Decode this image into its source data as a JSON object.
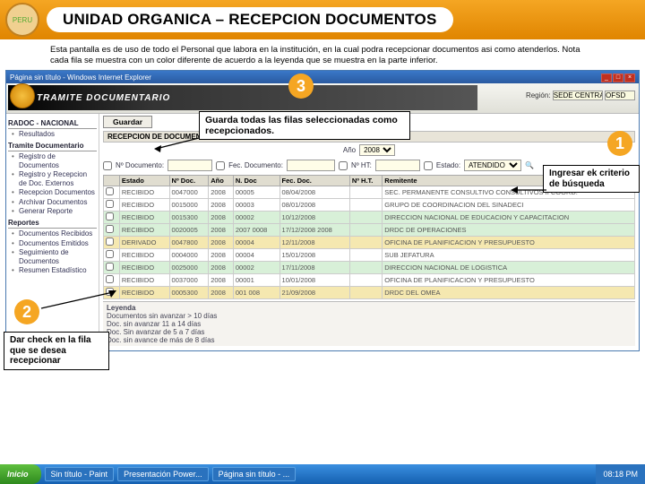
{
  "header": {
    "title": "UNIDAD ORGANICA – RECEPCION DOCUMENTOS",
    "logo_sub": "PERU"
  },
  "intro": "Esta pantalla es de uso de todo el Personal que labora en la institución, en la cual podra recepcionar documentos asi como atenderlos. Nota cada fila se muestra con un color diferente de acuerdo a la leyenda que se muestra en la parte inferior.",
  "ie": {
    "title": "Página sin título - Windows Internet Explorer",
    "app_banner": "TRAMITE DOCUMENTARIO",
    "region_lbl": "Región:",
    "region_val": "SEDE CENTRAL",
    "unit_lbl": "",
    "unit_val": "OFSD"
  },
  "sidebar": {
    "groups": [
      {
        "head": "RADOC - NACIONAL",
        "items": [
          "Resultados"
        ]
      },
      {
        "head": "Tramite Documentario",
        "items": [
          "Registro de Documentos",
          "Registro y Recepcion de Doc. Externos",
          "Recepcion Documentos",
          "Archivar Documentos",
          "Generar Reporte"
        ]
      },
      {
        "head": "Reportes",
        "items": [
          "Documentos Recibidos",
          "Documentos Emitidos",
          "Seguimiento de Documentos",
          "Resumen Estadístico"
        ]
      }
    ]
  },
  "main": {
    "guardar": "Guardar",
    "panel_title": "RECEPCION DE DOCUMENTOS INTERNOS",
    "year_lbl": "Año",
    "year_val": "2008",
    "filters": {
      "f1": "Nº Documento:",
      "f2": "Fec. Documento:",
      "f3": "Nº HT:",
      "f4": "Estado:",
      "estado_val": "ATENDIDO",
      "search_icon": "🔍"
    },
    "cols": [
      "",
      "Estado",
      "Nº Doc.",
      "Año",
      "N. Doc",
      "Fec. Doc.",
      "Nº H.T.",
      "Remitente"
    ],
    "rows": [
      [
        "RECIBIDO",
        "0047000",
        "2008",
        "00005",
        "08/04/2008",
        "",
        "SEC. PERMANENTE CONSULTIVO CONSULTIVOS II COORD."
      ],
      [
        "RECIBIDO",
        "0015000",
        "2008",
        "00003",
        "08/01/2008",
        "",
        "GRUPO DE COORDINACION DEL SINADECI"
      ],
      [
        "RECIBIDO",
        "0015300",
        "2008",
        "00002",
        "10/12/2008",
        "",
        "DIRECCION NACIONAL DE EDUCACION Y CAPACITACION"
      ],
      [
        "RECIBIDO",
        "0020005",
        "2008",
        "2007 0008",
        "17/12/2008 2008",
        "",
        "DRDC DE OPERACIONES"
      ],
      [
        "DERIVADO",
        "0047800",
        "2008",
        "00004",
        "12/11/2008",
        "",
        "OFICINA DE PLANIFICACION Y PRESUPUESTO"
      ],
      [
        "RECIBIDO",
        "0004000",
        "2008",
        "00004",
        "15/01/2008",
        "",
        "SUB JEFATURA"
      ],
      [
        "RECIBIDO",
        "0025000",
        "2008",
        "00002",
        "17/11/2008",
        "",
        "DIRECCION NACIONAL DE LOGISTICA"
      ],
      [
        "RECIBIDO",
        "0037000",
        "2008",
        "00001",
        "10/01/2008",
        "",
        "OFICINA DE PLANIFICACION Y PRESUPUESTO"
      ],
      [
        "RECIBIDO",
        "0005300",
        "2008",
        "001 008",
        "21/09/2008",
        "",
        "DRDC DEL OMEA"
      ]
    ],
    "legend_head": "Leyenda",
    "legend": [
      "Documentos sin avanzar > 10 días",
      "Doc. sin avanzar 11 a 14 días",
      "Doc. Sin avanzar de 5 a 7 días",
      "Doc. sin avance de más de 8 días"
    ]
  },
  "callouts": {
    "c1": {
      "num": "1",
      "text": "Ingresar ek criterio de búsqueda"
    },
    "c2": {
      "num": "2",
      "text": "Dar check en la fila que se desea recepcionar"
    },
    "c3": {
      "num": "3",
      "text": "Guarda todas las filas seleccionadas como recepcionados."
    }
  },
  "taskbar": {
    "start": "Inicio",
    "items": [
      "Sin título - Paint",
      "Presentación Power...",
      "Página sin título - ..."
    ],
    "time": "08:18 PM"
  }
}
